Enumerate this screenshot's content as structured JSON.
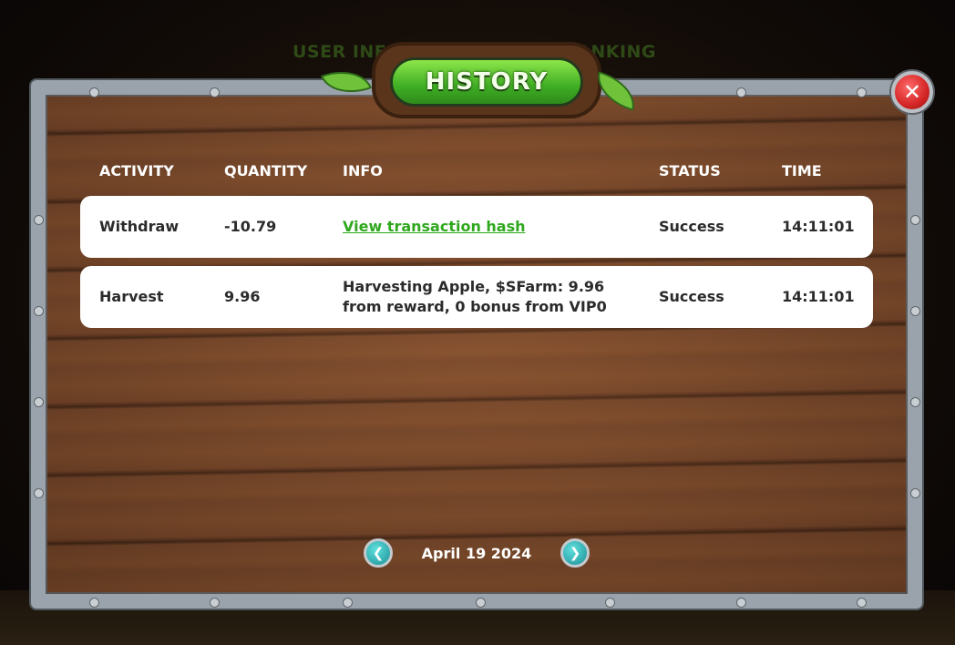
{
  "tabs": {
    "user_info": "USER INFO",
    "history": "HISTORY",
    "ranking": "RANKING"
  },
  "table": {
    "headers": [
      "ACTIVITY",
      "QUANTITY",
      "INFO",
      "STATUS",
      "TIME"
    ],
    "rows": [
      {
        "activity": "Withdraw",
        "quantity": "-10.79",
        "info": "View transaction hash",
        "info_is_link": true,
        "status": "Success",
        "time": "14:11:01"
      },
      {
        "activity": "Harvest",
        "quantity": "9.96",
        "info": "Harvesting Apple, $SFarm: 9.96 from reward, 0 bonus from VIP0",
        "info_is_link": false,
        "status": "Success",
        "time": "14:11:01"
      }
    ]
  },
  "pagination": {
    "date": "April 19 2024",
    "prev_icon": "chevron-left-icon",
    "next_icon": "chevron-right-icon"
  },
  "close_icon": "close-icon",
  "colors": {
    "history_button": "#3fae24",
    "close_button": "#d42525",
    "link": "#2fa81d",
    "nav_button": "#1b8f95"
  }
}
